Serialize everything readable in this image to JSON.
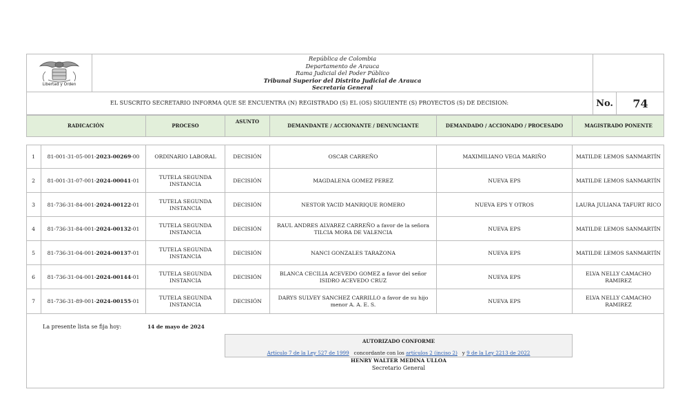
{
  "header": {
    "line1": "República de Colombia",
    "line2": "Departamento de Arauca",
    "line3": "Rama Judicial del Poder Público",
    "line4": "Tribunal Superior del Distrito Judicial de Arauca",
    "line5": "Secretaría General",
    "logo_caption": "Libertad y Orden"
  },
  "info": {
    "statement": "EL SUSCRITO SECRETARIO INFORMA QUE SE ENCUENTRA (N) REGISTRADO (S) EL (OS) SIGUIENTE (S) PROYECTOS (S) DE DECISION:",
    "no_label": "No.",
    "number": "74"
  },
  "columns": {
    "radicacion": "RADICACIÓN",
    "proceso": "PROCESO",
    "asunto": "ASUNTO",
    "demandante": "DEMANDANTE / ACCIONANTE / DENUNCIANTE",
    "demandado": "DEMANDADO / ACCIONADO / PROCESADO",
    "magistrado": "MAGISTRADO PONENTE"
  },
  "rows": [
    {
      "n": "1",
      "rad_pre": "81-001-31-05-001-",
      "rad_bold": "2023-00269",
      "rad_post": "-00",
      "proceso": "ORDINARIO LABORAL",
      "asunto": "DECISIÓN",
      "demandante": "OSCAR CARREÑO",
      "demandado": "MAXIMILIANO VEGA MARIÑO",
      "magistrado": "MATILDE LEMOS SANMARTÍN"
    },
    {
      "n": "2",
      "rad_pre": "81-001-31-07-001-",
      "rad_bold": "2024-00041",
      "rad_post": "-01",
      "proceso": "TUTELA SEGUNDA INSTANCIA",
      "asunto": "DECISIÓN",
      "demandante": "MAGDALENA GOMEZ PEREZ",
      "demandado": "NUEVA EPS",
      "magistrado": "MATILDE LEMOS SANMARTÍN"
    },
    {
      "n": "3",
      "rad_pre": "81-736-31-84-001-",
      "rad_bold": "2024-00122",
      "rad_post": "-01",
      "proceso": "TUTELA SEGUNDA INSTANCIA",
      "asunto": "DECISIÓN",
      "demandante": "NESTOR YACID MANRIQUE ROMERO",
      "demandado": "NUEVA EPS Y OTROS",
      "magistrado": "LAURA JULIANA TAFURT RICO"
    },
    {
      "n": "4",
      "rad_pre": "81-736-31-84-001-",
      "rad_bold": "2024-00132",
      "rad_post": "-01",
      "proceso": "TUTELA SEGUNDA INSTANCIA",
      "asunto": "DECISIÓN",
      "demandante": "RAUL ANDRES ALVAREZ CARREÑO a favor de la señora TILCIA MORA DE VALENCIA",
      "demandado": "NUEVA EPS",
      "magistrado": "MATILDE LEMOS SANMARTÍN"
    },
    {
      "n": "5",
      "rad_pre": "81-736-31-04-001-",
      "rad_bold": "2024-00137",
      "rad_post": "-01",
      "proceso": "TUTELA SEGUNDA INSTANCIA",
      "asunto": "DECISIÓN",
      "demandante": "NANCI GONZALES TARAZONA",
      "demandado": "NUEVA EPS",
      "magistrado": "MATILDE LEMOS SANMARTÍN"
    },
    {
      "n": "6",
      "rad_pre": "81-736-31-04-001-",
      "rad_bold": "2024-00144",
      "rad_post": "-01",
      "proceso": "TUTELA SEGUNDA INSTANCIA",
      "asunto": "DECISIÓN",
      "demandante": "BLANCA CECILIA ACEVEDO GOMEZ a favor del señor ISIDRO ACEVEDO CRUZ",
      "demandado": "NUEVA EPS",
      "magistrado": "ELVA NELLY CAMACHO RAMIREZ"
    },
    {
      "n": "7",
      "rad_pre": "81-736-31-89-001-",
      "rad_bold": "2024-00155",
      "rad_post": "-01",
      "proceso": "TUTELA SEGUNDA INSTANCIA",
      "asunto": "DECISIÓN",
      "demandante": "DARYS SULVEY SANCHEZ CARRILLO a favor de su hijo menor A. A. E. S.",
      "demandado": "NUEVA EPS",
      "magistrado": "ELVA NELLY CAMACHO RAMIREZ"
    }
  ],
  "footer": {
    "fija_label": "La presente lista se fija hoy:",
    "fija_date": "14 de mayo de 2024",
    "auth_title": "AUTORIZADO CONFORME",
    "law1": "Artículo 7 de la Ley 527 de 1999",
    "law_mid": "concordante con los",
    "law2": "artículos 2 (inciso 2)",
    "law_and": "y",
    "law3": "9 de la Ley 2213 de 2022",
    "signer": "HENRY WALTER MEDINA ULLOA",
    "signer_role": "Secretario General"
  },
  "colors": {
    "header_bg": "#e2efda",
    "border": "#bbbbbb",
    "link": "#2a5db0",
    "auth_bg": "#f2f2f2"
  }
}
